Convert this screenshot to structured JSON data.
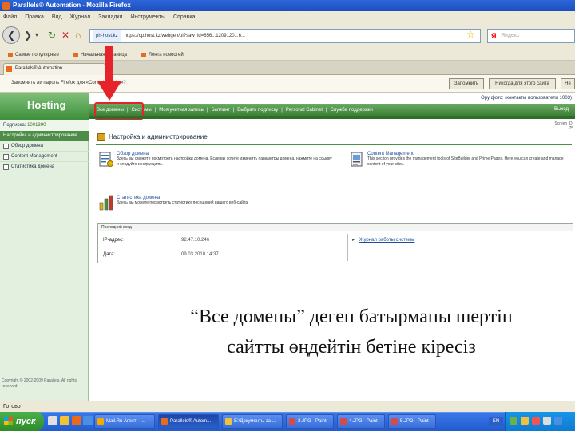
{
  "window": {
    "title": "Parallels® Automation - Mozilla Firefox"
  },
  "menu": [
    "Файл",
    "Правка",
    "Вид",
    "Журнал",
    "Закладки",
    "Инструменты",
    "Справка"
  ],
  "nav": {
    "url_site": "ph-host.kz",
    "url": "https://cp.host.kz/webgen/ui?saw_id=656...1209120...6...",
    "search_placeholder": "Яндекс"
  },
  "bookmarks": [
    "Самые популярные",
    "Начальная страница",
    "Лента новостей"
  ],
  "tab": {
    "label": "Parallels® Automation"
  },
  "login_bar": {
    "text": "Запомнить ли пароль Firefox для «Control.host.kz»?",
    "remember_label": "Запомнить",
    "never_label": "Никогда для этого сайта",
    "later_label": "Не"
  },
  "sidebar": {
    "logo": "Hosting",
    "subscription_label": "Подписка:",
    "subscription_value": "1001390",
    "section_title": "Настройка и администрирование",
    "items": [
      "Обзор домена",
      "Content Management",
      "Статистика домена"
    ],
    "footer": "Copyright © 2002-2009 Parallels. All rights reserved."
  },
  "header": {
    "account_line": "Ору фото: (контакты пользователя 1003)",
    "tabs": [
      "Все домены",
      "Системы",
      "Моя учетная запись",
      "Биллинг",
      "Выбрать подписку",
      "Personal Cabinet",
      "Служба поддержки"
    ],
    "exit_label": "Выход",
    "screen_id": "Screen ID: 75"
  },
  "main": {
    "section_title": "Настройка и администрирование",
    "features": [
      {
        "title": "Обзор домена",
        "desc": "Здесь вы сможете посмотреть настройки домена. Если вы хотите изменить параметры домена, нажмите на ссылку и следуйте инструкциям."
      },
      {
        "title": "Content Management",
        "desc": "This section provides the management tools of SiteBuilder and Prime Pages. Here you can create and manage content of your sites."
      },
      {
        "title": "Статистика домена",
        "desc": "Здесь вы можете посмотреть статистику посещений вашего веб-сайта."
      }
    ],
    "last_login": {
      "head": "Последний вход",
      "ip_label": "IP-адрес:",
      "ip_value": "92.47.10.246",
      "date_label": "Дата:",
      "date_value": "09.03.2010 14:37",
      "link": "Журнал работы системы"
    }
  },
  "caption": {
    "line1": "“Все домены”  деген батырманы шертіп",
    "line2": "сайтты  өңдейтін бетіне кіресіз"
  },
  "status": "Готово",
  "taskbar": {
    "start": "пуск",
    "tasks": [
      "Mail.Ru Агент - ...",
      "Parallels® Autom...",
      "E:\\Документы за ...",
      "3.JPG - Paint",
      "4.JPG - Paint",
      "5.JPG - Paint"
    ],
    "lang": "EN"
  }
}
